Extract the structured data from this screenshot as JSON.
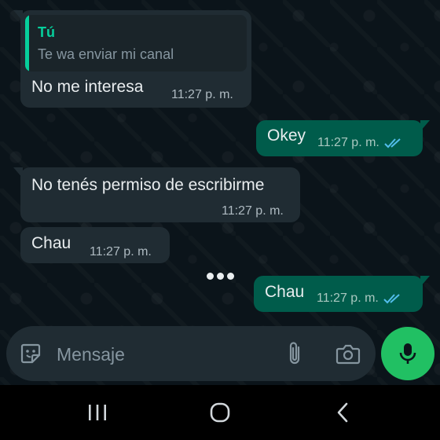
{
  "messages": [
    {
      "direction": "in",
      "quote": {
        "author": "Tú",
        "text": "Te wa enviar mi canal"
      },
      "text": "No me interesa",
      "time": "11:27 p. m."
    },
    {
      "direction": "out",
      "text": "Okey",
      "time": "11:27 p. m.",
      "status": "read"
    },
    {
      "direction": "in",
      "text": "No tenés permiso de escribirme",
      "time": "11:27 p. m."
    },
    {
      "direction": "in",
      "text": "Chau",
      "time": "11:27 p. m."
    },
    {
      "direction": "out",
      "text": "Chau",
      "time": "11:27 p. m.",
      "status": "read"
    }
  ],
  "composer": {
    "placeholder": "Mensaje",
    "icons": [
      "sticker-icon",
      "attach-icon",
      "camera-icon",
      "mic-icon"
    ]
  },
  "nav_bar": {
    "buttons": [
      "recent-apps",
      "home",
      "back"
    ]
  },
  "colors": {
    "background": "#0b141a",
    "incoming_bubble": "#202c33",
    "outgoing_bubble": "#005c4b",
    "accent": "#06cf9c",
    "read_ticks": "#53bdeb",
    "mic_button": "#21c063"
  }
}
